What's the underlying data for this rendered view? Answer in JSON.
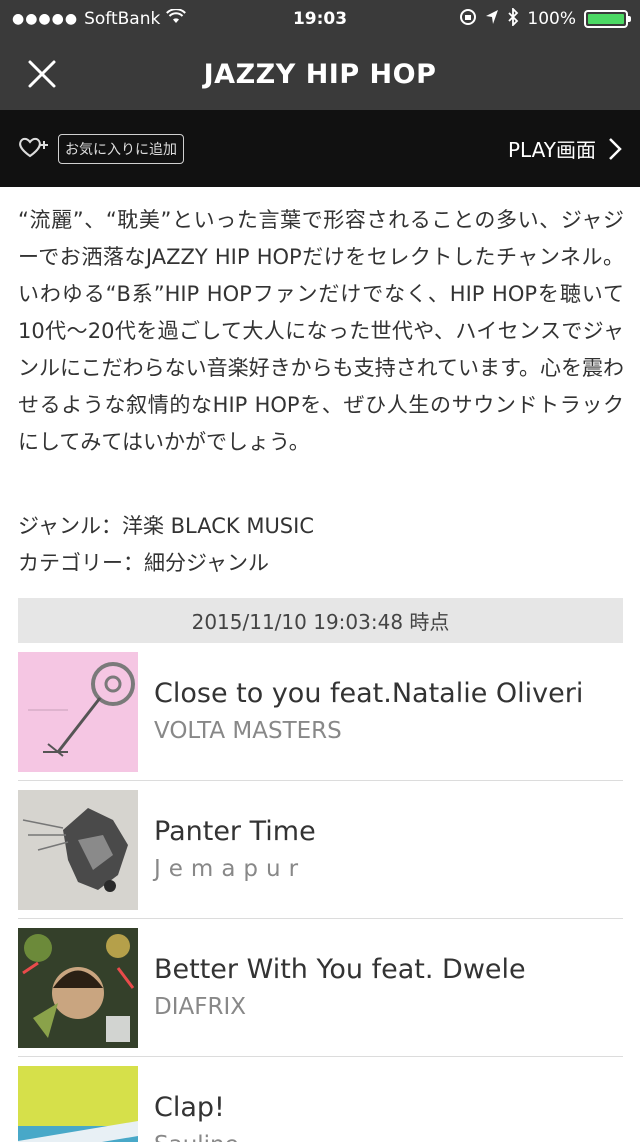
{
  "status_bar": {
    "carrier": "SoftBank",
    "time": "19:03",
    "battery": "100%",
    "battery_level": 1.0
  },
  "navbar": {
    "title": "JAZZY HIP HOP"
  },
  "toolbar": {
    "favorite_label": "お気に入りに追加",
    "play_label": "PLAY画面"
  },
  "channel": {
    "description": "“流麗”、“耽美”といった言葉で形容されることの多い、ジャジーでお洒落なJAZZY HIP HOPだけをセレクトしたチャンネル。いわゆる“B系”HIP HOPファンだけでなく、HIP HOPを聴いて10代〜20代を過ごして大人になった世代や、ハイセンスでジャンルにこだわらない音楽好きからも支持されています。心を震わせるような叙情的なHIP HOPを、ぜひ人生のサウンドトラックにしてみてはいかがでしょう。",
    "genre": "ジャンル：洋楽 BLACK MUSIC",
    "category": "カテゴリー：細分ジャンル"
  },
  "timestamp": "2015/11/10 19:03:48 時点",
  "tracks": [
    {
      "title": "Close to you feat.Natalie Oliveri",
      "artist": "VOLTA MASTERS"
    },
    {
      "title": "Panter Time",
      "artist": "Jemapur"
    },
    {
      "title": "Better With You feat. Dwele",
      "artist": "DIAFRIX"
    },
    {
      "title": "Clap!",
      "artist": "Sauline"
    }
  ],
  "colors": {
    "nav_bg": "#3a3a3a",
    "toolbar_bg": "#111111",
    "battery_green": "#4cd964",
    "timestamp_bg": "#e6e6e6"
  }
}
